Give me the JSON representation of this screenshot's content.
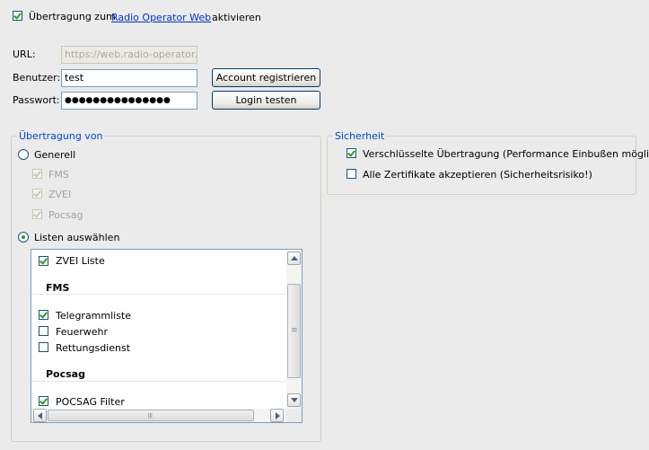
{
  "header": {
    "transfer_prefix": "Übertragung zum",
    "link_text": "Radio Operator Web",
    "transfer_suffix": "aktivieren",
    "enabled": true
  },
  "form": {
    "url_label": "URL:",
    "url_value": "https://web.radio-operator.de",
    "user_label": "Benutzer:",
    "user_value": "test",
    "password_label": "Passwort:",
    "password_value": "●●●●●●●●●●●●●●●",
    "register_button": "Account registrieren",
    "test_login_button": "Login testen"
  },
  "transfer_group": {
    "legend": "Übertragung von",
    "general_label": "Generell",
    "general_selected": false,
    "general_items": [
      {
        "label": "FMS",
        "checked": true
      },
      {
        "label": "ZVEI",
        "checked": true
      },
      {
        "label": "Pocsag",
        "checked": true
      }
    ],
    "select_lists_label": "Listen auswählen",
    "select_lists_selected": true,
    "list": {
      "items": [
        {
          "type": "item",
          "label": "ZVEI Liste",
          "checked": true
        },
        {
          "type": "section",
          "label": "FMS"
        },
        {
          "type": "item",
          "label": "Telegrammliste",
          "checked": true
        },
        {
          "type": "item",
          "label": "Feuerwehr",
          "checked": false
        },
        {
          "type": "item",
          "label": "Rettungsdienst",
          "checked": false
        },
        {
          "type": "section",
          "label": "Pocsag"
        },
        {
          "type": "item",
          "label": "POCSAG Filter",
          "checked": true
        }
      ]
    }
  },
  "security_group": {
    "legend": "Sicherheit",
    "encrypted_label": "Verschlüsselte Übertragung (Performance Einbußen möglich)",
    "encrypted_checked": true,
    "all_certs_label": "Alle Zertifikate akzeptieren (Sicherheitsrisiko!)",
    "all_certs_checked": false
  },
  "colors": {
    "background": "#ebebeb",
    "link": "#0033cc",
    "legend": "#0046d5",
    "check": "#21a121"
  }
}
